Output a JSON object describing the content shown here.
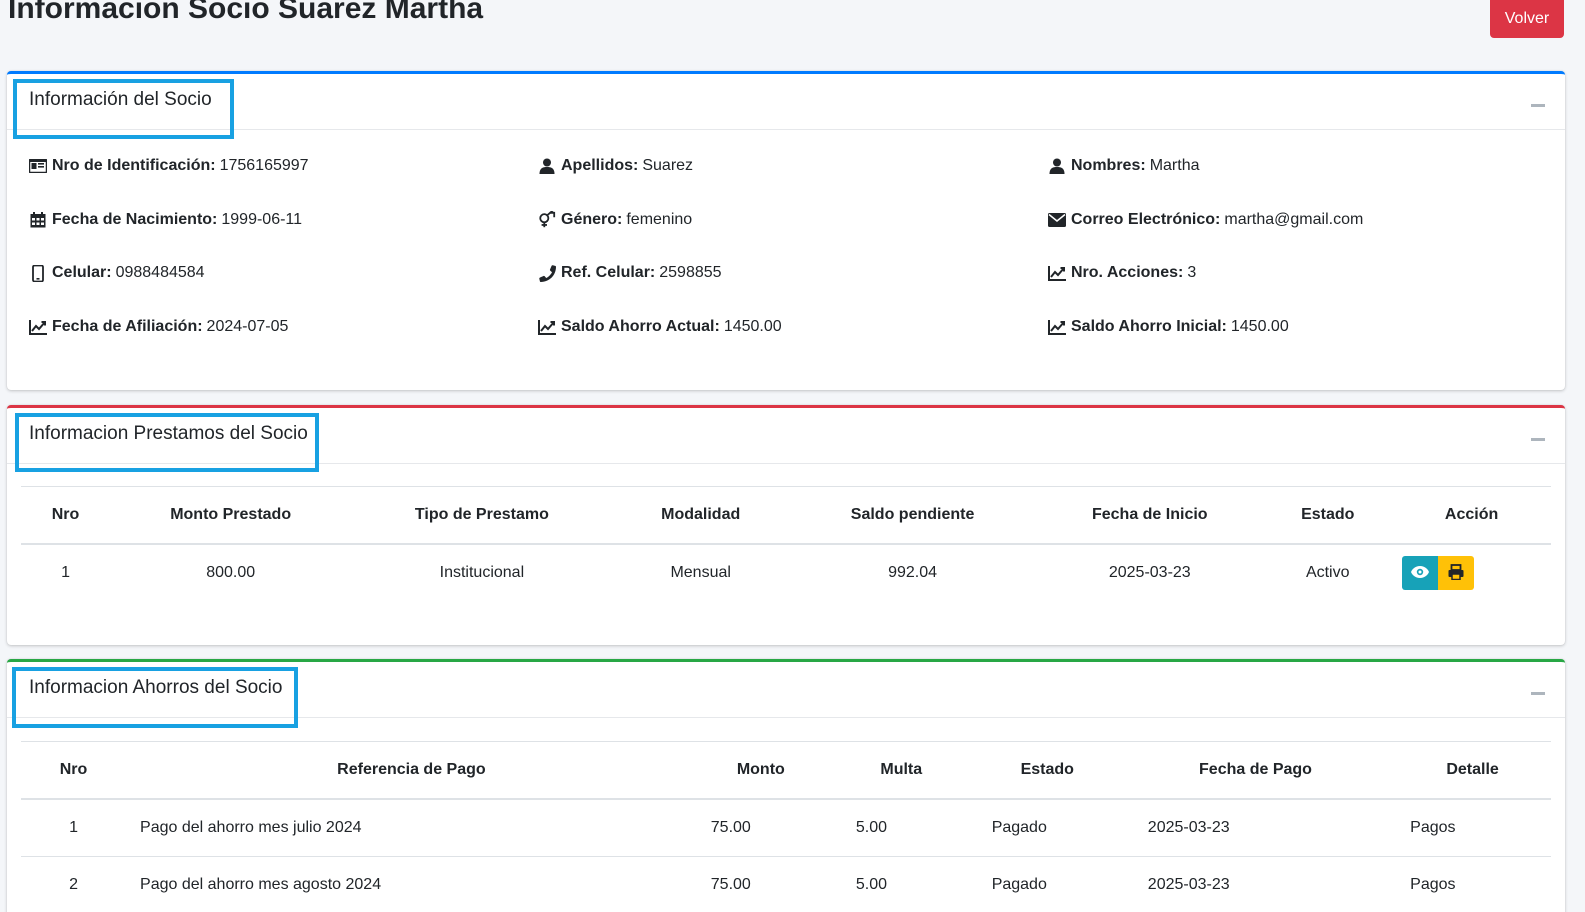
{
  "page": {
    "title": "Informacion Socio Suarez Martha",
    "back_label": "Volver"
  },
  "socio_card": {
    "title": "Información del Socio",
    "fields": [
      {
        "icon": "id-card-icon",
        "label": "Nro de Identificación:",
        "value": "1756165997"
      },
      {
        "icon": "user-icon",
        "label": "Apellidos:",
        "value": "Suarez"
      },
      {
        "icon": "user-icon",
        "label": "Nombres:",
        "value": "Martha"
      },
      {
        "icon": "calendar-icon",
        "label": "Fecha de Nacimiento:",
        "value": "1999-06-11"
      },
      {
        "icon": "gender-icon",
        "label": "Género:",
        "value": "femenino"
      },
      {
        "icon": "envelope-icon",
        "label": "Correo Electrónico:",
        "value": "martha@gmail.com"
      },
      {
        "icon": "mobile-icon",
        "label": "Celular:",
        "value": "0988484584"
      },
      {
        "icon": "phone-icon",
        "label": "Ref. Celular:",
        "value": "2598855"
      },
      {
        "icon": "chart-line-icon",
        "label": "Nro. Acciones:",
        "value": "3"
      },
      {
        "icon": "chart-line-icon",
        "label": "Fecha de Afiliación:",
        "value": "2024-07-05"
      },
      {
        "icon": "chart-line-icon",
        "label": "Saldo Ahorro Actual:",
        "value": "1450.00"
      },
      {
        "icon": "chart-line-icon",
        "label": "Saldo Ahorro Inicial:",
        "value": "1450.00"
      }
    ]
  },
  "prestamos_card": {
    "title": "Informacion Prestamos del Socio",
    "headers": [
      "Nro",
      "Monto Prestado",
      "Tipo de Prestamo",
      "Modalidad",
      "Saldo pendiente",
      "Fecha de Inicio",
      "Estado",
      "Acción"
    ],
    "rows": [
      [
        "1",
        "800.00",
        "Institucional",
        "Mensual",
        "992.04",
        "2025-03-23",
        "Activo"
      ]
    ]
  },
  "ahorros_card": {
    "title": "Informacion Ahorros del Socio",
    "headers": [
      "Nro",
      "Referencia de Pago",
      "Monto",
      "Multa",
      "Estado",
      "Fecha de Pago",
      "Detalle"
    ],
    "rows": [
      [
        "1",
        "Pago del ahorro mes julio 2024",
        "75.00",
        "5.00",
        "Pagado",
        "2025-03-23",
        "Pagos"
      ],
      [
        "2",
        "Pago del ahorro mes agosto 2024",
        "75.00",
        "5.00",
        "Pagado",
        "2025-03-23",
        "Pagos"
      ]
    ]
  },
  "colors": {
    "primary": "#007bff",
    "danger": "#dc3545",
    "success": "#28a745",
    "info": "#17a2b8",
    "warning": "#ffc107",
    "highlight": "#18a1e2"
  }
}
